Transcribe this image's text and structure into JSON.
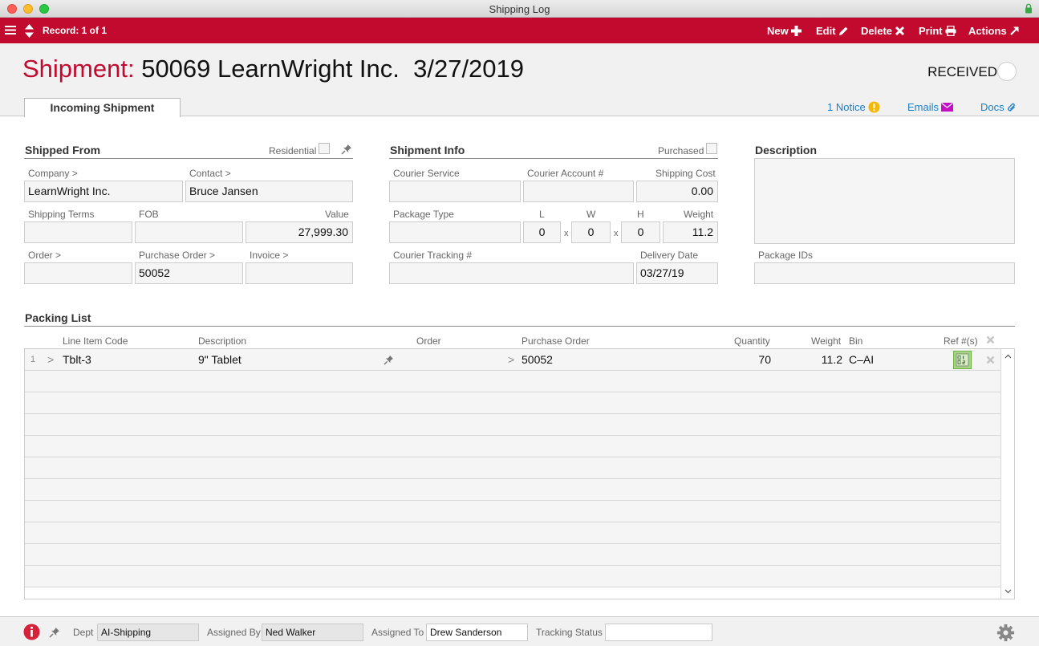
{
  "window": {
    "title": "Shipping Log"
  },
  "toolbar": {
    "record": "Record: 1 of 1",
    "new": "New",
    "edit": "Edit",
    "delete": "Delete",
    "print": "Print",
    "actions": "Actions"
  },
  "header": {
    "title_prefix": "Shipment:",
    "title_main": "50069 LearnWright Inc.  3/27/2019",
    "status": "RECEIVED",
    "tab": "Incoming Shipment",
    "notice": "1 Notice",
    "emails": "Emails",
    "docs": "Docs"
  },
  "shipped_from": {
    "title": "Shipped From",
    "residential_label": "Residential",
    "company_label": "Company >",
    "company": "LearnWright Inc.",
    "contact_label": "Contact >",
    "contact": "Bruce Jansen",
    "shipping_terms_label": "Shipping Terms",
    "shipping_terms": "",
    "fob_label": "FOB",
    "fob": "",
    "value_label": "Value",
    "value": "27,999.30",
    "order_label": "Order >",
    "order": "",
    "po_label": "Purchase Order >",
    "po": "50052",
    "invoice_label": "Invoice >",
    "invoice": ""
  },
  "shipment_info": {
    "title": "Shipment Info",
    "purchased_label": "Purchased",
    "courier_service_label": "Courier Service",
    "courier_service": "",
    "courier_account_label": "Courier Account #",
    "courier_account": "",
    "shipping_cost_label": "Shipping Cost",
    "shipping_cost": "0.00",
    "package_type_label": "Package Type",
    "package_type": "",
    "l_label": "L",
    "w_label": "W",
    "h_label": "H",
    "weight_label": "Weight",
    "l": "0",
    "w": "0",
    "h": "0",
    "weight": "11.2",
    "x": "x",
    "tracking_label": "Courier Tracking #",
    "tracking": "",
    "delivery_date_label": "Delivery Date",
    "delivery_date": "03/27/19"
  },
  "description": {
    "title": "Description",
    "text": "",
    "package_ids_label": "Package IDs",
    "package_ids": ""
  },
  "packing_list": {
    "title": "Packing List",
    "columns": {
      "line_item_code": "Line Item Code",
      "description": "Description",
      "order": "Order",
      "purchase_order": "Purchase Order",
      "quantity": "Quantity",
      "weight": "Weight",
      "bin": "Bin",
      "ref": "Ref #(s)"
    },
    "rows": [
      {
        "num": "1",
        "arrow": ">",
        "code": "Tblt-3",
        "description": "9\" Tablet",
        "order_arrow": ">",
        "purchase_order": "50052",
        "quantity": "70",
        "weight": "11.2",
        "bin": "C–AI"
      }
    ]
  },
  "footer": {
    "dept_label": "Dept",
    "dept": "AI-Shipping",
    "assigned_by_label": "Assigned By",
    "assigned_by": "Ned Walker",
    "assigned_to_label": "Assigned To",
    "assigned_to": "Drew Sanderson",
    "tracking_status_label": "Tracking Status",
    "tracking_status": ""
  },
  "colors": {
    "accent": "#c20a2f",
    "link": "#1d7fc9",
    "email": "#c40fc4",
    "notice": "#f5b800"
  }
}
